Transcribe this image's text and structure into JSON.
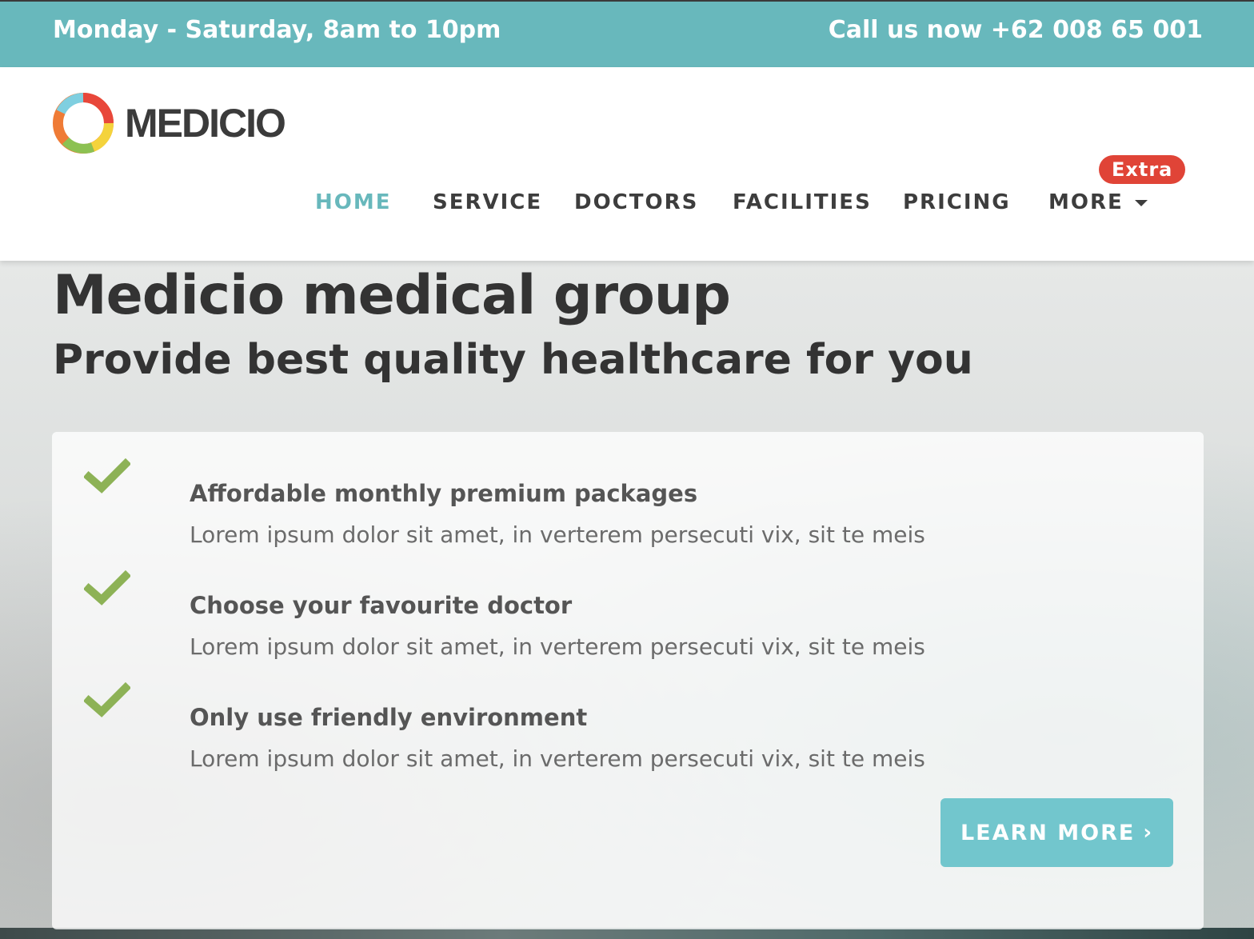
{
  "topbar": {
    "hours": "Monday - Saturday, 8am to 10pm",
    "phone": "Call us now +62 008 65 001"
  },
  "header": {
    "brand": "MEDICIO",
    "extra_badge": "Extra",
    "nav": [
      {
        "label": "HOME",
        "active": true
      },
      {
        "label": "SERVICE"
      },
      {
        "label": "DOCTORS"
      },
      {
        "label": "FACILITIES"
      },
      {
        "label": "PRICING"
      },
      {
        "label": "MORE",
        "dropdown": true
      }
    ]
  },
  "hero": {
    "title": "Medicio medical group",
    "subtitle": "Provide best quality healthcare for you"
  },
  "features": [
    {
      "icon": "checkmark-icon",
      "title": "Affordable monthly premium packages",
      "text": "Lorem ipsum dolor sit amet, in verterem persecuti vix, sit te meis"
    },
    {
      "icon": "checkmark-icon",
      "title": "Choose your favourite doctor",
      "text": "Lorem ipsum dolor sit amet, in verterem persecuti vix, sit te meis"
    },
    {
      "icon": "checkmark-icon",
      "title": "Only use friendly environment",
      "text": "Lorem ipsum dolor sit amet, in verterem persecuti vix, sit te meis"
    }
  ],
  "cta": {
    "label": "LEARN MORE",
    "chevron": "›"
  },
  "colors": {
    "accent": "#68b8bc",
    "button": "#72c6cd",
    "badge": "#e04437",
    "check": "#8db256"
  }
}
